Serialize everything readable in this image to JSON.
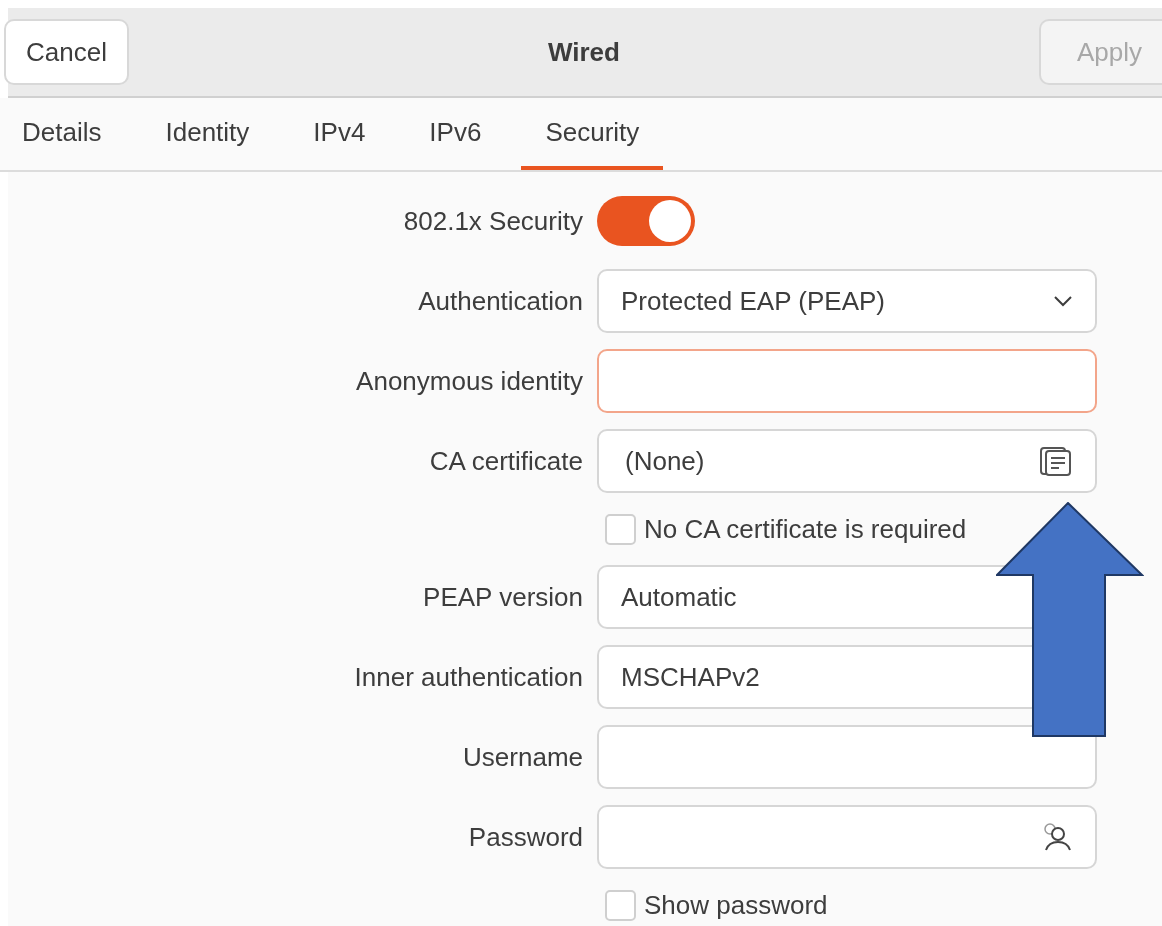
{
  "header": {
    "cancel": "Cancel",
    "title": "Wired",
    "apply": "Apply",
    "apply_disabled": true
  },
  "tabs": [
    {
      "label": "Details",
      "selected": false
    },
    {
      "label": "Identity",
      "selected": false
    },
    {
      "label": "IPv4",
      "selected": false
    },
    {
      "label": "IPv6",
      "selected": false
    },
    {
      "label": "Security",
      "selected": true
    }
  ],
  "form": [
    {
      "kind": "toggle",
      "label": "802.1x Security",
      "on": true
    },
    {
      "kind": "dropdown",
      "label": "Authentication",
      "value": "Protected EAP (PEAP)"
    },
    {
      "kind": "text",
      "label": "Anonymous identity",
      "focused": true
    },
    {
      "kind": "file",
      "label": "CA certificate",
      "value": "(None)"
    },
    {
      "kind": "checkbox",
      "label": "No CA certificate is required",
      "checked": false
    },
    {
      "kind": "dropdown",
      "label": "PEAP version",
      "value": "Automatic"
    },
    {
      "kind": "dropdown",
      "label": "Inner authentication",
      "value": "MSCHAPv2"
    },
    {
      "kind": "text",
      "label": "Username",
      "focused": false
    },
    {
      "kind": "password",
      "label": "Password"
    },
    {
      "kind": "checkbox",
      "label": "Show password",
      "checked": false
    }
  ]
}
